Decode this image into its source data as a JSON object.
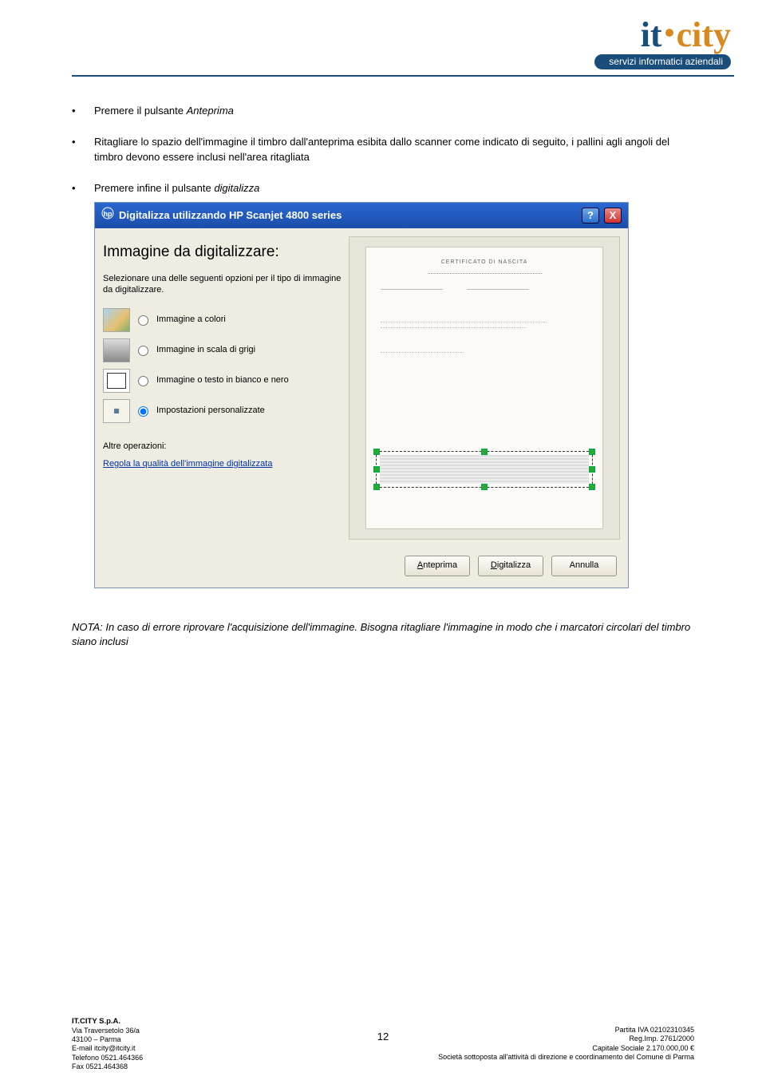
{
  "logo": {
    "it": "it",
    "city": "city",
    "tagline": "servizi informatici aziendali"
  },
  "bullets": {
    "b1_pre": "Premere il pulsante ",
    "b1_em": "Anteprima",
    "b2": "Ritagliare lo spazio dell'immagine il timbro dall'anteprima esibita dallo scanner come indicato di seguito, i pallini agli angoli del timbro devono essere inclusi nell'area ritagliata",
    "b3_pre": "Premere infine il pulsante ",
    "b3_em": "digitalizza"
  },
  "dialog": {
    "title": "Digitalizza utilizzando HP Scanjet 4800 series",
    "heading": "Immagine da digitalizzare:",
    "desc": "Selezionare una delle seguenti opzioni per il tipo di immagine da digitalizzare.",
    "opt_color": "Immagine a colori",
    "opt_gray": "Immagine in scala di grigi",
    "opt_bw": "Immagine o testo in bianco e nero",
    "opt_custom": "Impostazioni personalizzate",
    "other_label": "Altre operazioni:",
    "quality_link": "Regola la qualità dell'immagine digitalizzata",
    "preview_doc_title": "CERTIFICATO DI NASCITA",
    "btn_preview": "Anteprima",
    "btn_scan": "Digitalizza",
    "btn_cancel": "Annulla"
  },
  "note": "NOTA: In caso di errore riprovare l'acquisizione dell'immagine. Bisogna ritagliare l'immagine in modo che i marcatori circolari del timbro siano inclusi",
  "page_number": "12",
  "footer": {
    "company": "IT.CITY S.p.A.",
    "addr1": "Via Traversetolo 36/a",
    "addr2": "43100 – Parma",
    "email": "E-mail itcity@itcity.it",
    "tel": "Telefono 0521.464366",
    "fax": "Fax 0521.464368",
    "piva": "Partita IVA 02102310345",
    "reg": "Reg.Imp. 2761/2000",
    "capitale": "Capitale Sociale 2.170.000,00 €",
    "societa": "Società sottoposta all'attività di direzione e coordinamento del Comune di Parma"
  }
}
